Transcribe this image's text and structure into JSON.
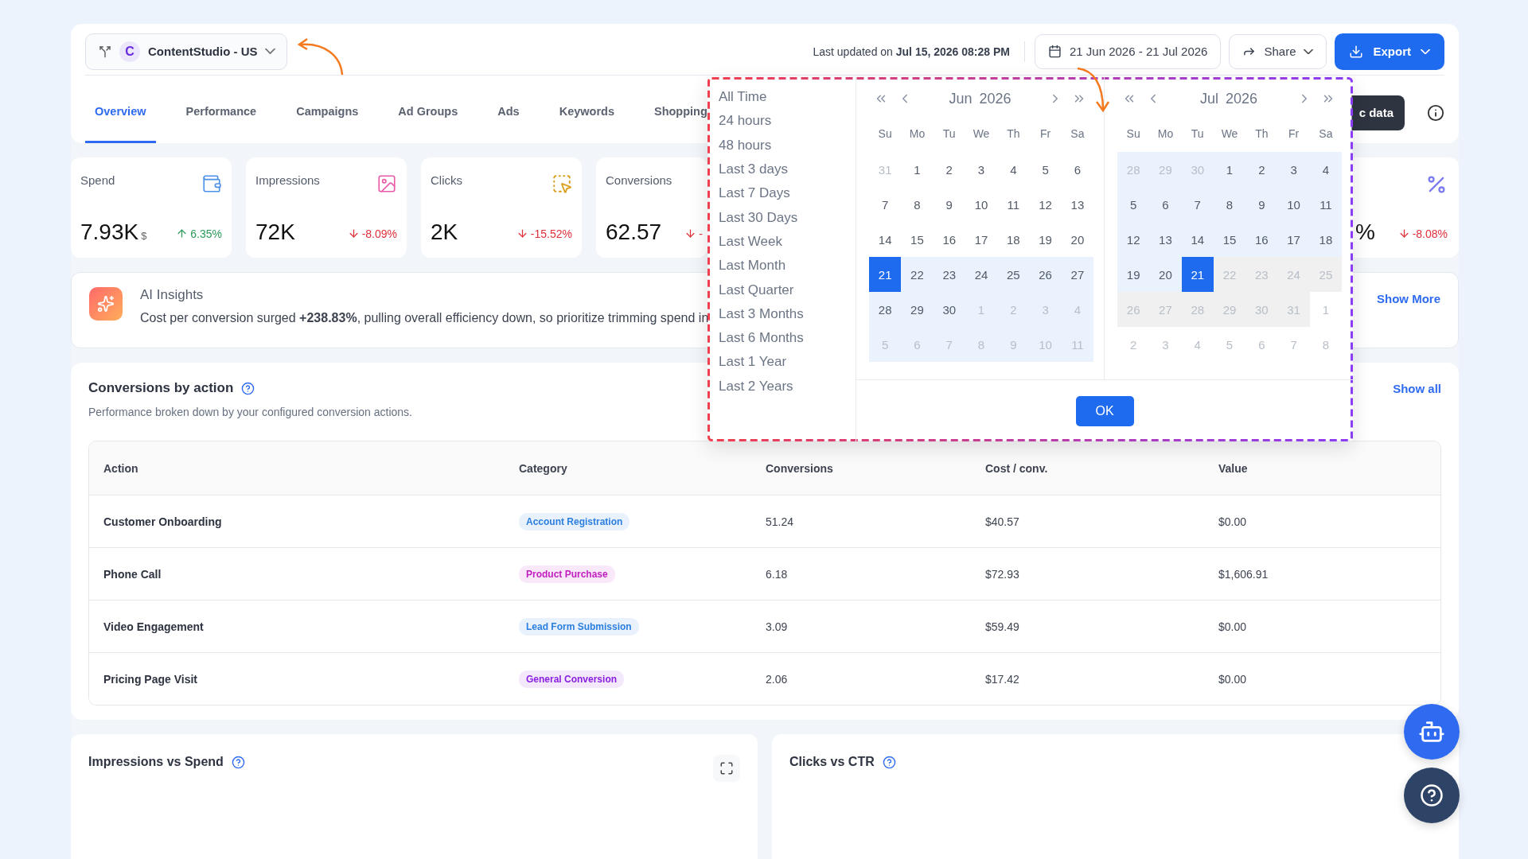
{
  "account": {
    "initial": "C",
    "name": "ContentStudio - US"
  },
  "last_updated": "Last updated on **Jul 15, 2026 08:28 PM**",
  "date_range": "21 Jun 2026 - 21 Jul 2026",
  "share": "Share",
  "export": "Export",
  "tabs": [
    {
      "label": "Overview",
      "selected": true
    },
    {
      "label": "Performance",
      "selected": false
    },
    {
      "label": "Campaigns",
      "selected": false
    },
    {
      "label": "Ad Groups",
      "selected": false
    },
    {
      "label": "Ads",
      "selected": false
    },
    {
      "label": "Keywords",
      "selected": false
    },
    {
      "label": "Shopping",
      "selected": false
    }
  ],
  "data_button": "c data",
  "stats": [
    {
      "kind": "spend",
      "label": "Spend",
      "value": "7.93K",
      "unit": "$",
      "change": "6.35%",
      "rising": true
    },
    {
      "kind": "impressions",
      "label": "Impressions",
      "value": "72K",
      "change": "-8.09%",
      "rising": false
    },
    {
      "kind": "clicks",
      "label": "Clicks",
      "value": "2K",
      "change": "-15.52%",
      "rising": false
    },
    {
      "kind": "conversions",
      "label": "Conversions",
      "value": "62.57",
      "change": "-",
      "rising": false
    },
    {
      "kind": "percent",
      "value": "%",
      "change": "-8.08%",
      "rising": false
    }
  ],
  "insights": {
    "title": "AI Insights",
    "text": "Cost per conversion surged **+238.83%**, pulling overall efficiency down, so prioritize trimming spend in",
    "link": "Show More"
  },
  "conversions": {
    "title": "Conversions by action",
    "subtitle": "Performance broken down by your configured conversion actions.",
    "link": "Show all",
    "columns": [
      "Action",
      "Category",
      "Conversions",
      "Cost / conv.",
      "Value"
    ],
    "rows": [
      {
        "action": "Customer Onboarding",
        "category": "Account Registration",
        "color": "#2b7fe0",
        "conversions": "51.24",
        "cost": "$40.57",
        "value": "$0.00"
      },
      {
        "action": "Phone Call",
        "category": "Product Purchase",
        "color": "#c01ec0",
        "conversions": "6.18",
        "cost": "$72.93",
        "value": "$1,606.91"
      },
      {
        "action": "Video Engagement",
        "category": "Lead Form Submission",
        "color": "#2b7fe0",
        "conversions": "3.09",
        "cost": "$59.49",
        "value": "$0.00"
      },
      {
        "action": "Pricing Page Visit",
        "category": "General Conversion",
        "color": "#8a1ee0",
        "conversions": "2.06",
        "cost": "$17.42",
        "value": "$0.00"
      }
    ]
  },
  "charts": [
    {
      "title": "Impressions vs Spend",
      "expandable": true
    },
    {
      "title": "Clicks vs CTR",
      "expandable": false
    }
  ],
  "picker": {
    "presets": [
      "All Time",
      "24 hours",
      "48 hours",
      "Last 3 days",
      "Last 7 Days",
      "Last 30 Days",
      "Last Week",
      "Last Month",
      "Last Quarter",
      "Last 3 Months",
      "Last 6 Months",
      "Last 1 Year",
      "Last 2 Years"
    ],
    "ok": "OK",
    "months": [
      {
        "month": "Jun",
        "year": "2026",
        "weekdays": [
          "Su",
          "Mo",
          "Tu",
          "We",
          "Th",
          "Fr",
          "Sa"
        ],
        "days": [
          {
            "day": "31",
            "kind": "outside",
            "selected": false
          },
          {
            "day": "1",
            "kind": "plain",
            "selected": false
          },
          {
            "day": "2",
            "kind": "plain",
            "selected": false
          },
          {
            "day": "3",
            "kind": "plain",
            "selected": false
          },
          {
            "day": "4",
            "kind": "plain",
            "selected": false
          },
          {
            "day": "5",
            "kind": "plain",
            "selected": false
          },
          {
            "day": "6",
            "kind": "plain",
            "selected": false
          },
          {
            "day": "7",
            "kind": "plain",
            "selected": false
          },
          {
            "day": "8",
            "kind": "plain",
            "selected": false
          },
          {
            "day": "9",
            "kind": "plain",
            "selected": false
          },
          {
            "day": "10",
            "kind": "plain",
            "selected": false
          },
          {
            "day": "11",
            "kind": "plain",
            "selected": false
          },
          {
            "day": "12",
            "kind": "plain",
            "selected": false
          },
          {
            "day": "13",
            "kind": "plain",
            "selected": false
          },
          {
            "day": "14",
            "kind": "plain",
            "selected": false
          },
          {
            "day": "15",
            "kind": "plain",
            "selected": false
          },
          {
            "day": "16",
            "kind": "plain",
            "selected": false
          },
          {
            "day": "17",
            "kind": "plain",
            "selected": false
          },
          {
            "day": "18",
            "kind": "plain",
            "selected": false
          },
          {
            "day": "19",
            "kind": "plain",
            "selected": false
          },
          {
            "day": "20",
            "kind": "plain",
            "selected": false
          },
          {
            "day": "21",
            "kind": "range",
            "selected": true
          },
          {
            "day": "22",
            "kind": "range",
            "selected": false
          },
          {
            "day": "23",
            "kind": "range",
            "selected": false
          },
          {
            "day": "24",
            "kind": "range",
            "selected": false
          },
          {
            "day": "25",
            "kind": "range",
            "selected": false
          },
          {
            "day": "26",
            "kind": "range",
            "selected": false
          },
          {
            "day": "27",
            "kind": "range",
            "selected": false
          },
          {
            "day": "28",
            "kind": "range",
            "selected": false
          },
          {
            "day": "29",
            "kind": "range",
            "selected": false
          },
          {
            "day": "30",
            "kind": "range",
            "selected": false
          },
          {
            "day": "1",
            "kind": "range-outside",
            "selected": false
          },
          {
            "day": "2",
            "kind": "range-outside",
            "selected": false
          },
          {
            "day": "3",
            "kind": "range-outside",
            "selected": false
          },
          {
            "day": "4",
            "kind": "range-outside",
            "selected": false
          },
          {
            "day": "5",
            "kind": "range-outside",
            "selected": false
          },
          {
            "day": "6",
            "kind": "range-outside",
            "selected": false
          },
          {
            "day": "7",
            "kind": "range-outside",
            "selected": false
          },
          {
            "day": "8",
            "kind": "range-outside",
            "selected": false
          },
          {
            "day": "9",
            "kind": "range-outside",
            "selected": false
          },
          {
            "day": "10",
            "kind": "range-outside",
            "selected": false
          },
          {
            "day": "11",
            "kind": "range-outside",
            "selected": false
          }
        ]
      },
      {
        "month": "Jul",
        "year": "2026",
        "weekdays": [
          "Su",
          "Mo",
          "Tu",
          "We",
          "Th",
          "Fr",
          "Sa"
        ],
        "days": [
          {
            "day": "28",
            "kind": "range-outside",
            "selected": false
          },
          {
            "day": "29",
            "kind": "range-outside",
            "selected": false
          },
          {
            "day": "30",
            "kind": "range-outside",
            "selected": false
          },
          {
            "day": "1",
            "kind": "range",
            "selected": false
          },
          {
            "day": "2",
            "kind": "range",
            "selected": false
          },
          {
            "day": "3",
            "kind": "range",
            "selected": false
          },
          {
            "day": "4",
            "kind": "range",
            "selected": false
          },
          {
            "day": "5",
            "kind": "range",
            "selected": false
          },
          {
            "day": "6",
            "kind": "range",
            "selected": false
          },
          {
            "day": "7",
            "kind": "range",
            "selected": false
          },
          {
            "day": "8",
            "kind": "range",
            "selected": false
          },
          {
            "day": "9",
            "kind": "range",
            "selected": false
          },
          {
            "day": "10",
            "kind": "range",
            "selected": false
          },
          {
            "day": "11",
            "kind": "range",
            "selected": false
          },
          {
            "day": "12",
            "kind": "range",
            "selected": false
          },
          {
            "day": "13",
            "kind": "range",
            "selected": false
          },
          {
            "day": "14",
            "kind": "range",
            "selected": false
          },
          {
            "day": "15",
            "kind": "range",
            "selected": false
          },
          {
            "day": "16",
            "kind": "range",
            "selected": false
          },
          {
            "day": "17",
            "kind": "range",
            "selected": false
          },
          {
            "day": "18",
            "kind": "range",
            "selected": false
          },
          {
            "day": "19",
            "kind": "range",
            "selected": false
          },
          {
            "day": "20",
            "kind": "range",
            "selected": false
          },
          {
            "day": "21",
            "kind": "range",
            "selected": true
          },
          {
            "day": "22",
            "kind": "disabled",
            "selected": false
          },
          {
            "day": "23",
            "kind": "disabled",
            "selected": false
          },
          {
            "day": "24",
            "kind": "disabled",
            "selected": false
          },
          {
            "day": "25",
            "kind": "disabled",
            "selected": false
          },
          {
            "day": "26",
            "kind": "disabled",
            "selected": false
          },
          {
            "day": "27",
            "kind": "disabled",
            "selected": false
          },
          {
            "day": "28",
            "kind": "disabled",
            "selected": false
          },
          {
            "day": "29",
            "kind": "disabled",
            "selected": false
          },
          {
            "day": "30",
            "kind": "disabled",
            "selected": false
          },
          {
            "day": "31",
            "kind": "disabled",
            "selected": false
          },
          {
            "day": "1",
            "kind": "outside",
            "selected": false
          },
          {
            "day": "2",
            "kind": "outside",
            "selected": false
          },
          {
            "day": "3",
            "kind": "outside",
            "selected": false
          },
          {
            "day": "4",
            "kind": "outside",
            "selected": false
          },
          {
            "day": "5",
            "kind": "outside",
            "selected": false
          },
          {
            "day": "6",
            "kind": "outside",
            "selected": false
          },
          {
            "day": "7",
            "kind": "outside",
            "selected": false
          },
          {
            "day": "8",
            "kind": "outside",
            "selected": false
          }
        ]
      }
    ]
  }
}
